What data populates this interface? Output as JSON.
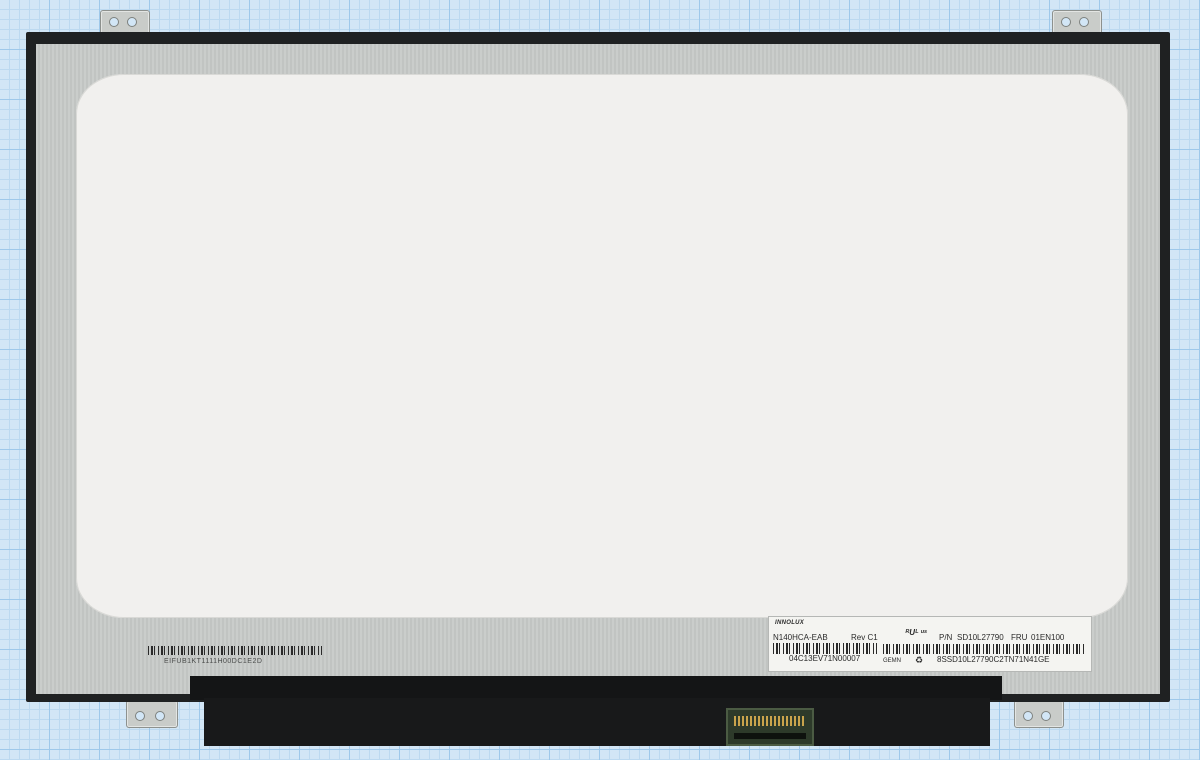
{
  "label": {
    "brand": "INNOLUX",
    "model": "N140HCA-EAB",
    "revision": "Rev C1",
    "ul_mark": "ᴿUᴸ ᵘˢ",
    "part_number_label": "P/N",
    "part_number": "SD10L27790",
    "fru_label": "FRU",
    "fru": "01EN100",
    "serial_number": "04C13EV71N00007",
    "gemn": "GEMN",
    "serial_number_2": "8SSD10L27790C2TN71N41GE"
  },
  "panel_code": "EIFUB1KT1111H00DC1E2D",
  "icons": {
    "recycle": "recycle-icon"
  },
  "colors": {
    "background": "#d2e6f6",
    "bezel": "#1f2122",
    "frame": "#c7cac8",
    "screen": "#f1f0ee"
  }
}
